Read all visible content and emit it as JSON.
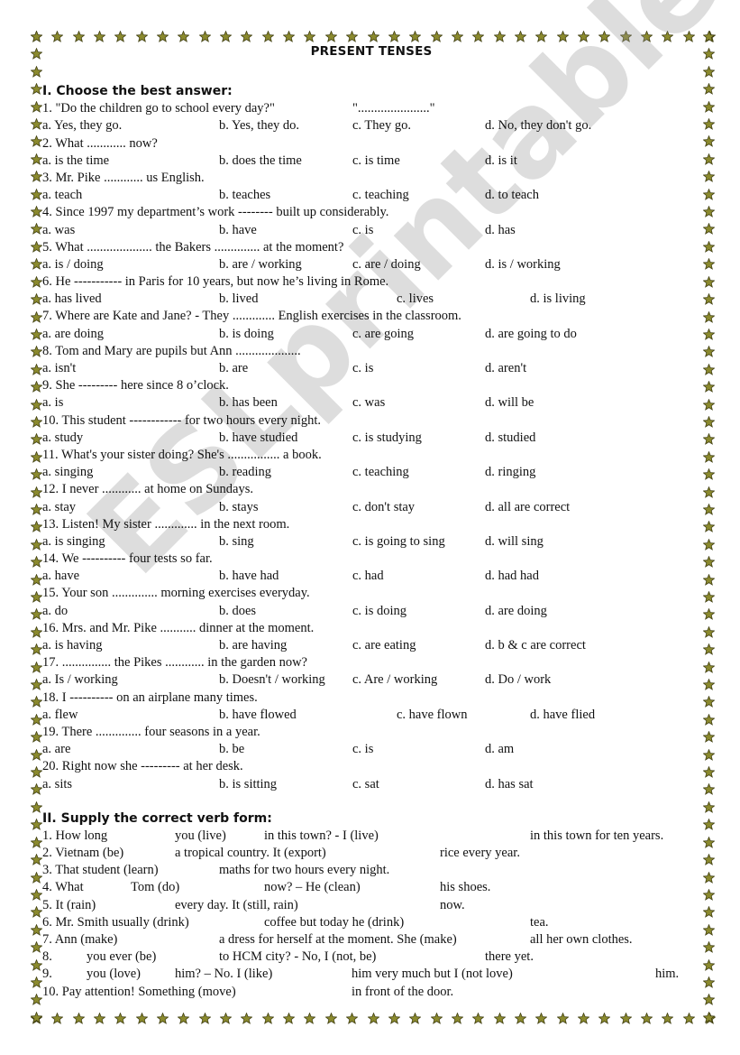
{
  "document": {
    "title": "PRESENT TENSES",
    "border_icon": "star-icon",
    "border_color": "#8b8a2e",
    "watermark": "ESLprintables.com"
  },
  "section1": {
    "heading": "I. Choose the best answer:",
    "questions": [
      {
        "q": "1. \"Do the children go to school every day?\"",
        "q_extra": "\"......................\"",
        "a": "a.  Yes, they go.",
        "b": "b.  Yes, they do.",
        "c": "c. They go.",
        "d": "d. No, they don't go."
      },
      {
        "q": "2. What ............ now?",
        "a": "a. is the time",
        "b": "b. does the time",
        "c": "c. is time",
        "d": "d. is it"
      },
      {
        "q": "3. Mr. Pike ............ us English.",
        "a": "a. teach",
        "b": "b. teaches",
        "c": "c. teaching",
        "d": "d. to teach"
      },
      {
        "q": "4. Since 1997 my department’s work -------- built up considerably.",
        "a": "a. was",
        "b": "b. have",
        "c": "c. is",
        "d": "d. has"
      },
      {
        "q": "5. What .................... the Bakers .............. at the moment?",
        "a": "a. is / doing",
        "b": "b. are / working",
        "c": "c. are / doing",
        "d": "d. is / working"
      },
      {
        "q": "6. He ----------- in Paris for 10 years, but now he’s living in Rome.",
        "a": "a. has lived",
        "b": "b. lived",
        "c": "c. lives",
        "d": "d. is living",
        "wide": true
      },
      {
        "q": "7. Where are Kate and Jane? - They ............. English exercises in the classroom.",
        "a": "a. are doing",
        "b": "b. is doing",
        "c": "c. are going",
        "d": "d. are going to do"
      },
      {
        "q": "8. Tom and Mary are pupils but Ann ....................",
        "a": "a. isn't",
        "b": "b. are",
        "c": "c. is",
        "d": "d. aren't"
      },
      {
        "q": "9. She --------- here since 8 o’clock.",
        "a": "a. is",
        "b": "b. has been",
        "c": "c. was",
        "d": "d. will be"
      },
      {
        "q": "10. This student ------------  for two hours every night.",
        "a": "a. study",
        "b": "b. have studied",
        "c": "c. is studying",
        "d": "d. studied"
      },
      {
        "q": "11. What's your sister doing? She's ................ a book.",
        "a": "a. singing",
        "b": "b. reading",
        "c": "c. teaching",
        "d": "d. ringing"
      },
      {
        "q": "12. I never ............ at home on Sundays.",
        "a": "a. stay",
        "b": "b. stays",
        "c": "c. don't stay",
        "d": "d. all are correct"
      },
      {
        "q": "13. Listen! My sister ............. in the next room.",
        "a": "a. is singing",
        "b": "b. sing",
        "c": "c. is going to sing",
        "d": "d. will sing"
      },
      {
        "q": "14. We ---------- four tests so far.",
        "a": "a. have",
        "b": "b. have had",
        "c": "c. had",
        "d": "d. had had"
      },
      {
        "q": "15. Your son .............. morning exercises everyday.",
        "a": "a. do",
        "b": "b. does",
        "c": "c. is doing",
        "d": "d. are doing"
      },
      {
        "q": "16. Mrs. and Mr. Pike ........... dinner at the moment.",
        "a": "a. is having",
        "b": "b. are having",
        "c": "c. are eating",
        "d": "d. b & c are correct"
      },
      {
        "q": "17. ............... the Pikes ............ in the garden now?",
        "a": "a. Is / working",
        "b": "b. Doesn't / working",
        "c": "c. Are / working",
        "d": "d. Do / work"
      },
      {
        "q": "18. I ---------- on an airplane many times.",
        "a": "a. flew",
        "b": "b. have flowed",
        "c": "c. have flown",
        "d": "d. have flied",
        "wide": true
      },
      {
        "q": "19. There .............. four seasons in a year.",
        "a": "a. are",
        "b": "b. be",
        "c": "c. is",
        "d": "d. am"
      },
      {
        "q": "20. Right now she --------- at her desk.",
        "a": "a. sits",
        "b": "b. is sitting",
        "c": "c. sat",
        "d": "d. has sat"
      }
    ]
  },
  "section2": {
    "heading": "II. Supply the correct verb form:",
    "items": [
      [
        "1. How long",
        "you (live)",
        "in this town? - I (live)",
        "in this town for ten years."
      ],
      [
        "2. Vietnam (be)",
        "a tropical country. It (export)",
        "rice every year."
      ],
      [
        "3. That student (learn)",
        "maths for two hours every night."
      ],
      [
        "4. What",
        "Tom (do)",
        "now? – He (clean)",
        "his shoes."
      ],
      [
        "5. It (rain)",
        "every day. It (still, rain)",
        "now."
      ],
      [
        "6. Mr. Smith usually (drink)",
        "coffee but today he (drink)",
        "tea."
      ],
      [
        "7. Ann (make)",
        "a dress for herself at the moment. She (make)",
        "all her own clothes."
      ],
      [
        "8.",
        "you ever (be)",
        "to HCM city? - No, I (not, be)",
        "there yet."
      ],
      [
        "9.",
        "you (love)",
        "him? – No. I (like)",
        "him very much but I (not love)",
        "him."
      ],
      [
        "10. Pay attention! Something (move)",
        "in front of the door."
      ]
    ]
  }
}
